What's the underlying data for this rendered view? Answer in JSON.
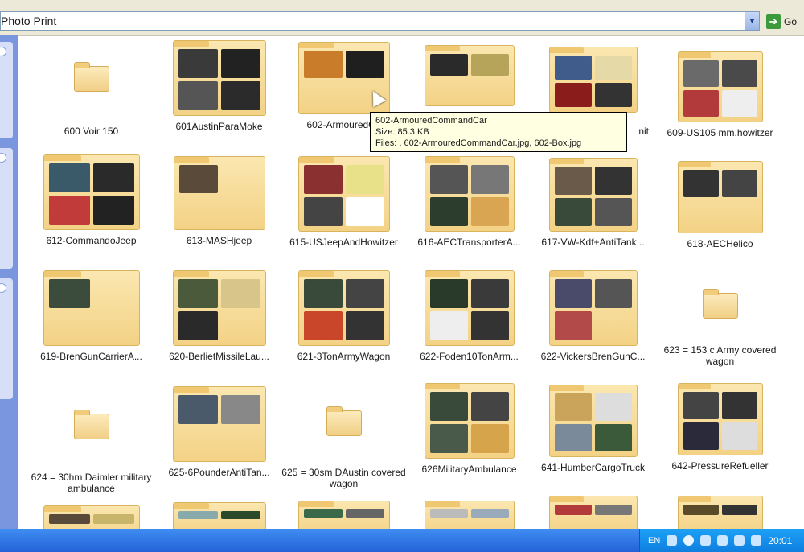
{
  "window": {
    "title": "Photo Print"
  },
  "address": {
    "value": "Photo Print",
    "go_label": "Go"
  },
  "tooltip": {
    "name": "602-ArmouredCommandCar",
    "size": "Size: 85.3 KB",
    "files": "Files: , 602-ArmouredCommandCar.jpg, 602-Box.jpg"
  },
  "items": [
    {
      "label": "600 Voir 150"
    },
    {
      "label": "601AustinParaMoke"
    },
    {
      "label": "602-ArmouredCo"
    },
    {
      "label": ""
    },
    {
      "label": "nit"
    },
    {
      "label": "609-US105 mm.howitzer"
    },
    {
      "label": "612-CommandoJeep"
    },
    {
      "label": "613-MASHjeep"
    },
    {
      "label": "615-USJeepAndHowitzer"
    },
    {
      "label": "616-AECTransporterA..."
    },
    {
      "label": "617-VW-Kdf+AntiTank..."
    },
    {
      "label": "618-AECHelico"
    },
    {
      "label": "619-BrenGunCarrierA..."
    },
    {
      "label": "620-BerlietMissileLau..."
    },
    {
      "label": "621-3TonArmyWagon"
    },
    {
      "label": "622-Foden10TonArm..."
    },
    {
      "label": "622-VickersBrenGunC..."
    },
    {
      "label": "623 = 153 c Army covered wagon"
    },
    {
      "label": "624 = 30hm Daimler military ambulance"
    },
    {
      "label": "625-6PounderAntiTan..."
    },
    {
      "label": "625 = 30sm DAustin covered wagon"
    },
    {
      "label": "626MilitaryAmbulance"
    },
    {
      "label": "641-HumberCargoTruck"
    },
    {
      "label": "642-PressureRefueller"
    }
  ],
  "taskbar": {
    "language": "EN",
    "clock": "20:01"
  },
  "colors": {
    "folder": "#f3d285",
    "taskbar": "#2461d8",
    "tooltip_bg": "#ffffe1"
  }
}
